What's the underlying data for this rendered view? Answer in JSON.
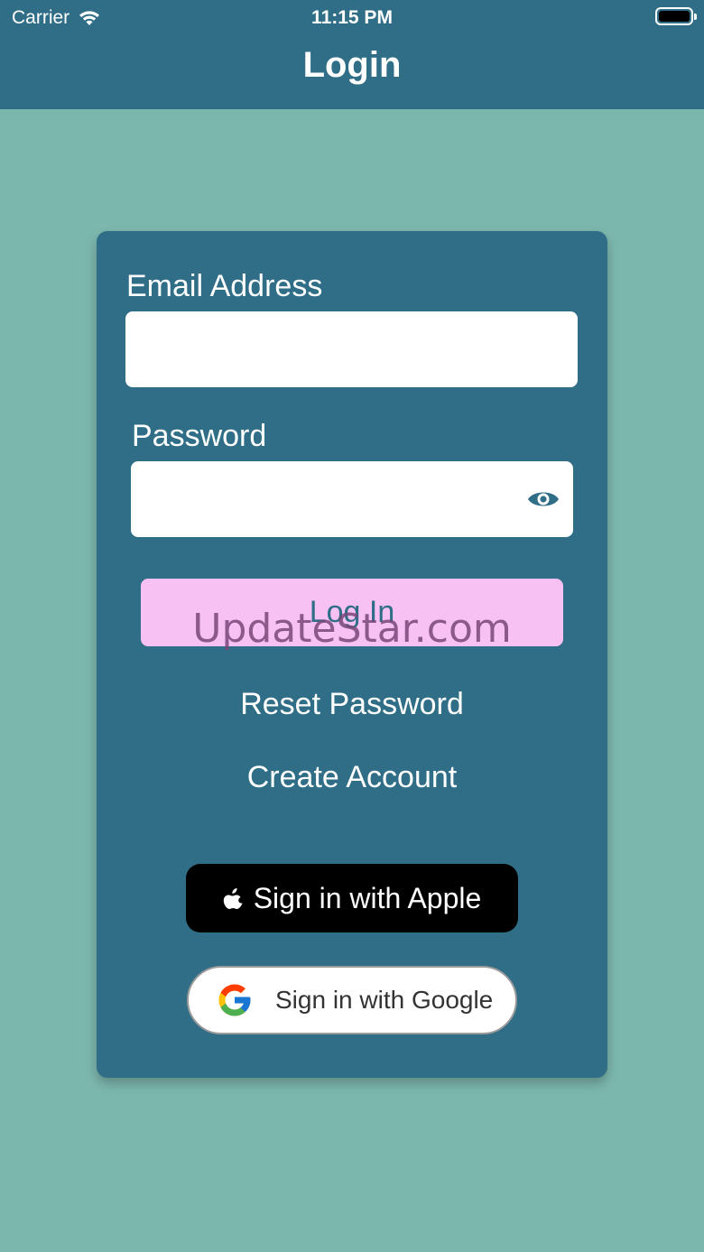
{
  "status_bar": {
    "carrier": "Carrier",
    "time": "11:15 PM",
    "wifi_icon": "wifi-icon",
    "battery_icon": "battery-icon"
  },
  "nav": {
    "title": "Login"
  },
  "form": {
    "email_label": "Email Address",
    "email_value": "",
    "password_label": "Password",
    "password_value": "",
    "show_password_icon": "eye-icon",
    "login_label": "Log In",
    "reset_password_label": "Reset Password",
    "create_account_label": "Create Account"
  },
  "social": {
    "apple_label": "Sign in with Apple",
    "google_label": "Sign in with Google"
  },
  "watermark": "UpdateStar.com",
  "colors": {
    "background": "#7cb7ae",
    "header": "#2f6e86",
    "card": "#2f6e86",
    "login_button": "#f7c1f3"
  }
}
